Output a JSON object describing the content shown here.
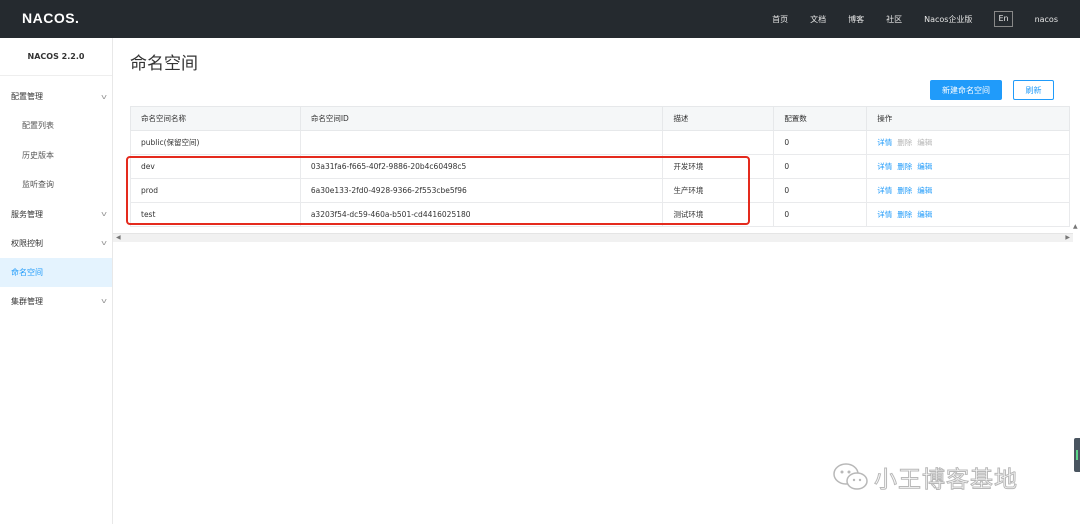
{
  "brand": {
    "logo_text": "NACOS."
  },
  "topnav": {
    "items": [
      "首页",
      "文档",
      "博客",
      "社区",
      "Nacos企业版"
    ],
    "lang": "En",
    "user": "nacos"
  },
  "sidebar": {
    "version": "NACOS 2.2.0",
    "config_group": "配置管理",
    "config_items": [
      "配置列表",
      "历史版本",
      "监听查询"
    ],
    "service_group": "服务管理",
    "auth_group": "权限控制",
    "namespace_item": "命名空间",
    "cluster_group": "集群管理"
  },
  "main": {
    "title": "命名空间",
    "new_button": "新建命名空间",
    "refresh_button": "刷新"
  },
  "table": {
    "headers": [
      "命名空间名称",
      "命名空间ID",
      "描述",
      "配置数",
      "操作"
    ],
    "rows": [
      {
        "name": "public(保留空间)",
        "id": "",
        "desc": "",
        "count": "0",
        "ops": [
          "详情",
          "删除",
          "编辑"
        ],
        "ops_enabled": false
      },
      {
        "name": "dev",
        "id": "03a31fa6-f665-40f2-9886-20b4c60498c5",
        "desc": "开发环境",
        "count": "0",
        "ops": [
          "详情",
          "删除",
          "编辑"
        ],
        "ops_enabled": true
      },
      {
        "name": "prod",
        "id": "6a30e133-2fd0-4928-9366-2f553cbe5f96",
        "desc": "生产环境",
        "count": "0",
        "ops": [
          "详情",
          "删除",
          "编辑"
        ],
        "ops_enabled": true
      },
      {
        "name": "test",
        "id": "a3203f54-dc59-460a-b501-cd4416025180",
        "desc": "测试环境",
        "count": "0",
        "ops": [
          "详情",
          "删除",
          "编辑"
        ],
        "ops_enabled": true
      }
    ]
  },
  "watermark": {
    "text": "小王博客基地"
  },
  "colors": {
    "accent": "#209bfa",
    "topbar": "#252a2f",
    "highlight": "#e42a1d",
    "active_bg": "#e4f3fe"
  }
}
